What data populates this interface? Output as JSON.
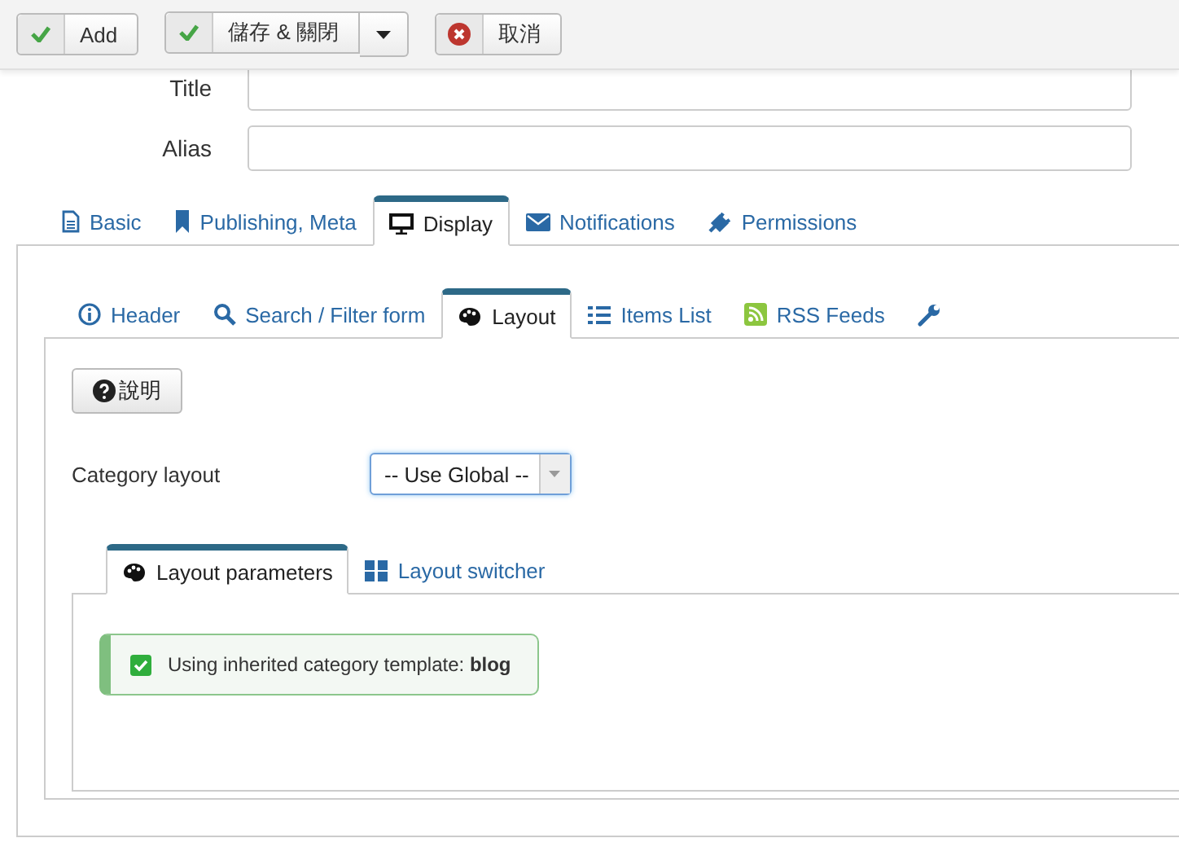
{
  "toolbar": {
    "buttons": [
      {
        "label": "Add",
        "kind": "save",
        "dropdown": false
      },
      {
        "label": "儲存 & 關閉",
        "kind": "save",
        "dropdown": true
      },
      {
        "label": "取消",
        "kind": "cancel",
        "dropdown": false
      }
    ]
  },
  "fields": [
    {
      "label": "Title"
    },
    {
      "label": "Alias"
    }
  ],
  "tabs": [
    {
      "label": "Basic",
      "selected": false
    },
    {
      "label": "Publishing, Meta",
      "selected": false
    },
    {
      "label": "Display",
      "selected": true
    },
    {
      "label": "Notifications",
      "selected": false
    },
    {
      "label": "Permissions",
      "selected": false
    }
  ],
  "subtabs": [
    {
      "label": "Header",
      "selected": false
    },
    {
      "label": "Search / Filter form",
      "selected": false
    },
    {
      "label": "Layout",
      "selected": true
    },
    {
      "label": "Items List",
      "selected": false
    },
    {
      "label": "RSS Feeds",
      "selected": false
    },
    {
      "selected": false
    }
  ],
  "help_button": {
    "label": "說明"
  },
  "category_layout": {
    "label": "Category layout",
    "value": "-- Use Global --"
  },
  "layout_tabs": [
    {
      "label": "Layout parameters",
      "selected": true
    },
    {
      "label": "Layout switcher",
      "selected": false
    }
  ],
  "alert": {
    "text": "Using inherited category template: **blog**"
  }
}
